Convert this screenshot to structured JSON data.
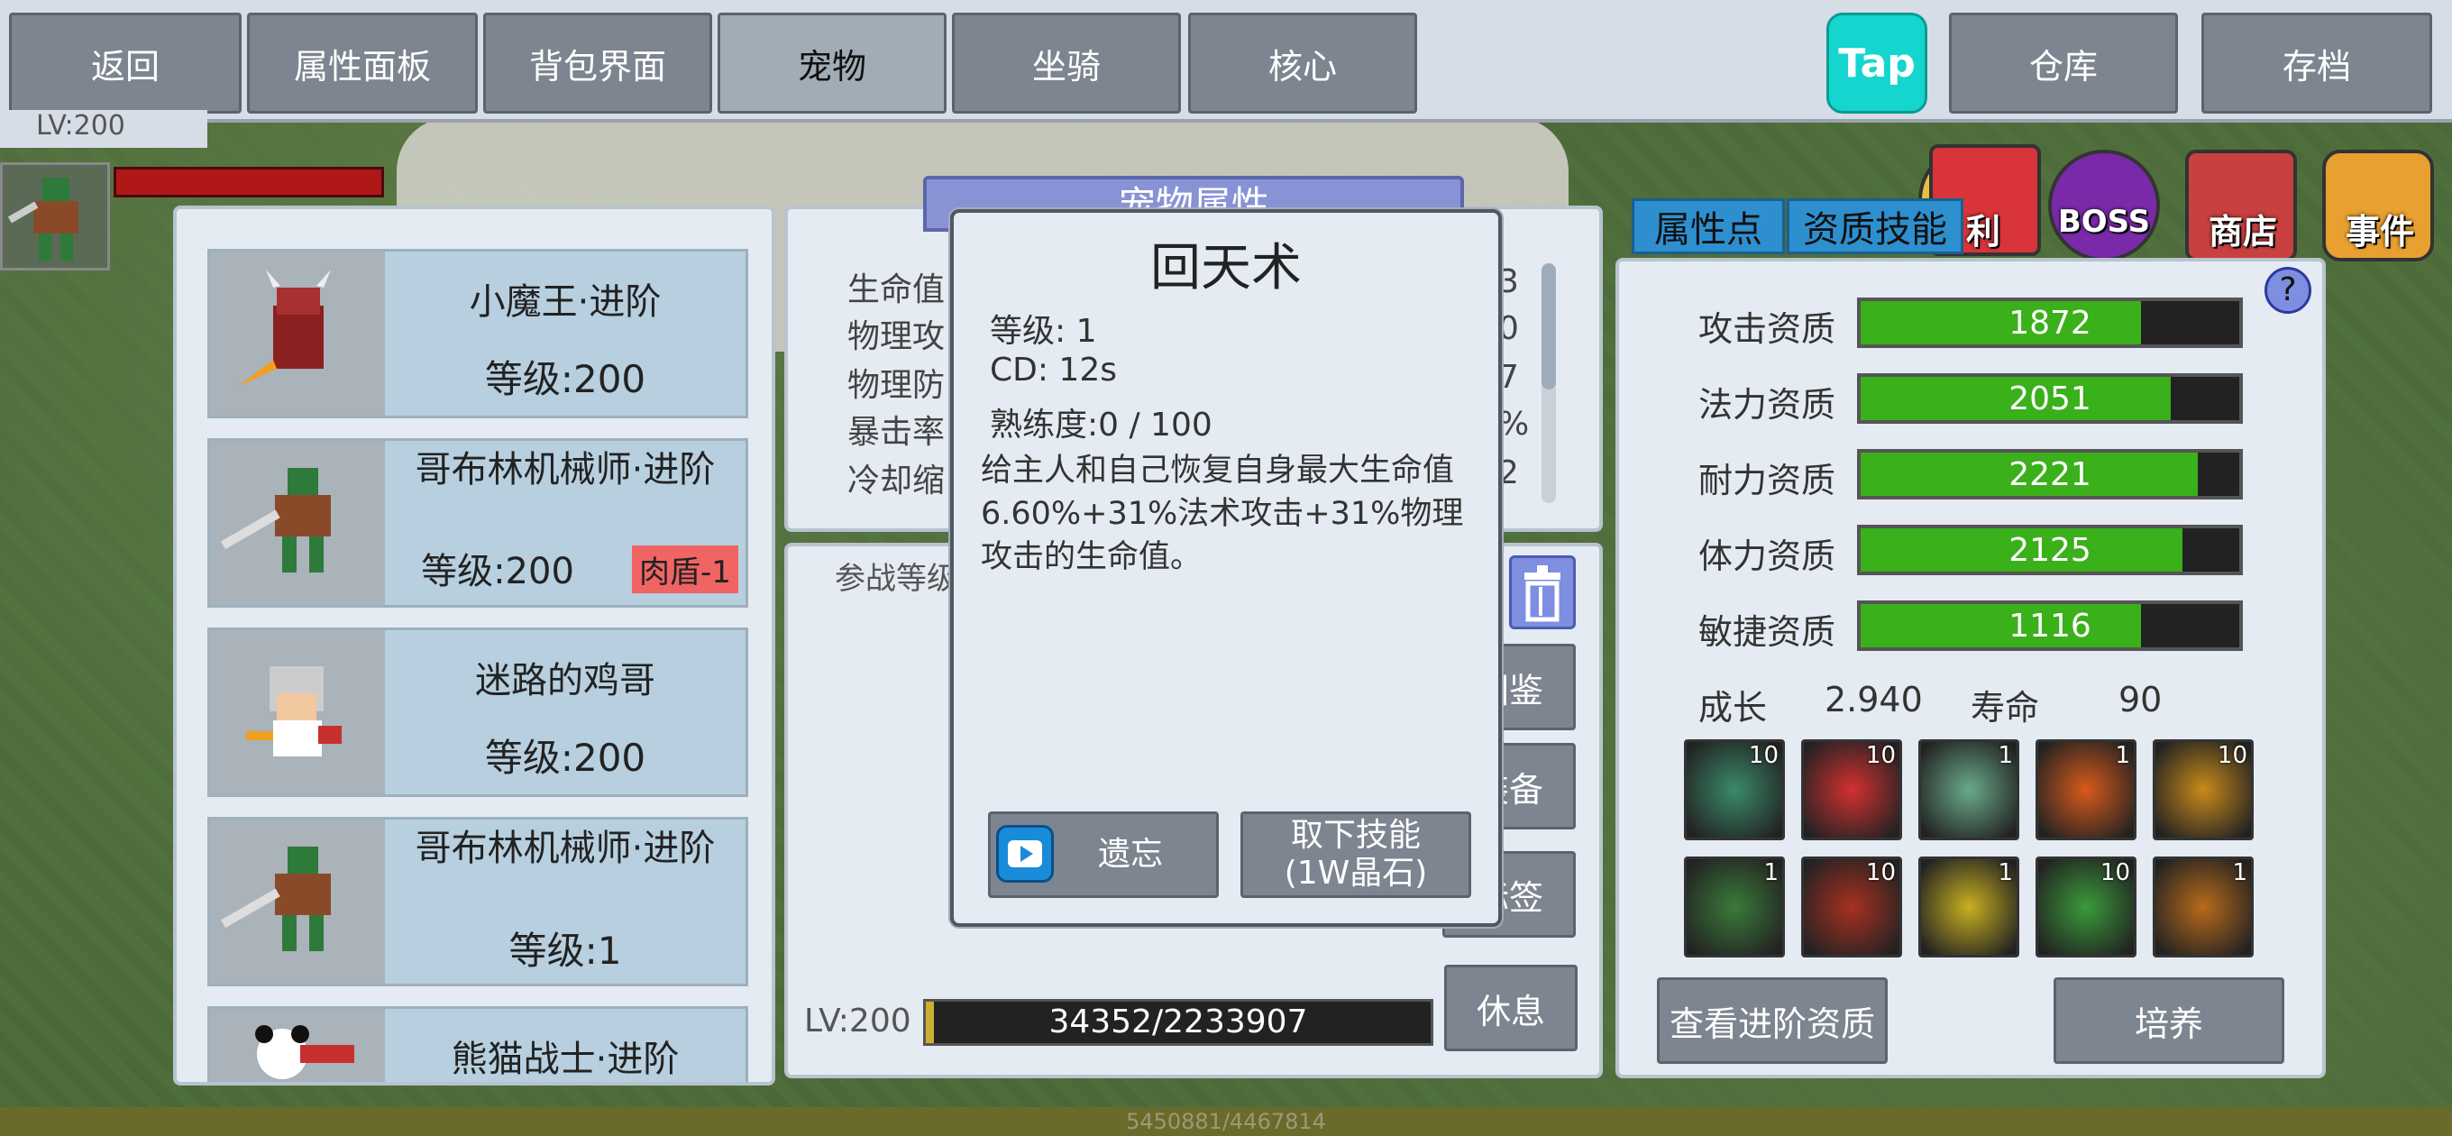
{
  "nav": {
    "back": "返回",
    "attributes": "属性面板",
    "bag": "背包界面",
    "pet": "宠物",
    "mount": "坐骑",
    "core": "核心",
    "tap_logo": "Tap",
    "warehouse": "仓库",
    "save": "存档"
  },
  "player": {
    "level": "LV:200"
  },
  "top_icons": {
    "welfare": "利",
    "boss": "BOSS",
    "shop": "商店",
    "event": "事件"
  },
  "pets": [
    {
      "name": "小魔王·进阶",
      "level": "等级:200",
      "tag": ""
    },
    {
      "name": "哥布林机械师·进阶",
      "level": "等级:200",
      "tag": "肉盾-1"
    },
    {
      "name": "迷路的鸡哥",
      "level": "等级:200",
      "tag": ""
    },
    {
      "name": "哥布林机械师·进阶",
      "level": "等级:1",
      "tag": ""
    },
    {
      "name": "熊猫战士·进阶",
      "level": "",
      "tag": ""
    }
  ],
  "attr_panel": {
    "title": "宠物属性",
    "labels": [
      "生命值",
      "物理攻",
      "物理防",
      "暴击率",
      "冷却缩"
    ],
    "values": [
      "3",
      "0",
      "7",
      "%",
      "2"
    ]
  },
  "battle_panel": {
    "label": "参战等级",
    "side_buttons": [
      "图鉴",
      "装备",
      "标签",
      "休息"
    ],
    "level": "LV:200",
    "exp_text": "34352/2233907",
    "exp_fraction": 0.0154
  },
  "popup": {
    "title": "回天术",
    "level": "等级: 1",
    "cd": "CD: 12s",
    "proficiency": "熟练度:0 / 100",
    "description": "给主人和自己恢复自身最大生命值6.60%+31%法术攻击+31%物理攻击的生命值。",
    "forget_button": "遗忘",
    "remove_button": "取下技能\n(1W晶石)"
  },
  "right_tabs": {
    "points": "属性点",
    "aptitude": "资质技能"
  },
  "aptitudes": [
    {
      "label": "攻击资质",
      "value": "1872",
      "fraction": 0.74
    },
    {
      "label": "法力资质",
      "value": "2051",
      "fraction": 0.82
    },
    {
      "label": "耐力资质",
      "value": "2221",
      "fraction": 0.89
    },
    {
      "label": "体力资质",
      "value": "2125",
      "fraction": 0.85
    },
    {
      "label": "敏捷资质",
      "value": "1116",
      "fraction": 0.74
    }
  ],
  "growth": {
    "growth_label": "成长",
    "growth_value": "2.940",
    "life_label": "寿命",
    "life_value": "90"
  },
  "skills": [
    {
      "name": "dragon-scale-icon",
      "count": "10",
      "color": "#3a8a6a"
    },
    {
      "name": "heart-up-icon",
      "count": "10",
      "color": "#d23030"
    },
    {
      "name": "wind-sword-icon",
      "count": "1",
      "color": "#6aaa8a"
    },
    {
      "name": "fireball-icon",
      "count": "1",
      "color": "#d85a1a"
    },
    {
      "name": "spear-fire-icon",
      "count": "10",
      "color": "#c88a1a"
    },
    {
      "name": "boot-axe-icon",
      "count": "1",
      "color": "#3a7a3a"
    },
    {
      "name": "demon-roar-icon",
      "count": "10",
      "color": "#a83020"
    },
    {
      "name": "knight-icon",
      "count": "1",
      "color": "#c8b020"
    },
    {
      "name": "green-arrow-icon",
      "count": "10",
      "color": "#3a9a3a"
    },
    {
      "name": "spiky-creature-icon",
      "count": "1",
      "color": "#b86a1a"
    }
  ],
  "growth_buttons": {
    "view_advanced": "查看进阶资质",
    "train": "培养"
  },
  "footer": {
    "hp_text": "5450881/4467814"
  }
}
